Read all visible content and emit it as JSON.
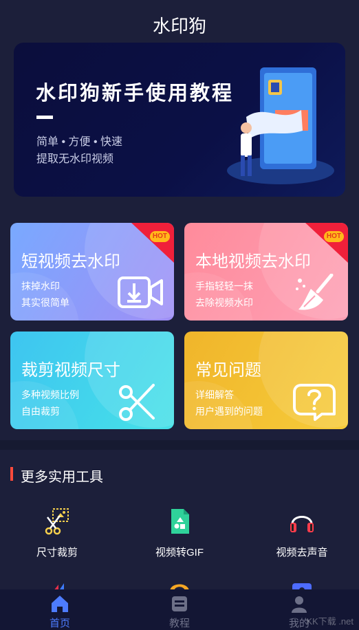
{
  "app": {
    "title": "水印狗"
  },
  "banner": {
    "title": "水印狗新手使用教程",
    "sub1": "简单 • 方便 • 快速",
    "sub2": "提取无水印视频"
  },
  "cards": [
    {
      "title": "短视频去水印",
      "line1": "抹掉水印",
      "line2": "其实很简单",
      "badge": "HOT",
      "icon": "video-download-icon"
    },
    {
      "title": "本地视频去水印",
      "line1": "手指轻轻一抹",
      "line2": "去除视频水印",
      "badge": "HOT",
      "icon": "broom-icon"
    },
    {
      "title": "裁剪视频尺寸",
      "line1": "多种视频比例",
      "line2": "自由裁剪",
      "icon": "scissors-icon"
    },
    {
      "title": "常见问题",
      "line1": "详细解答",
      "line2": "用户遇到的问题",
      "icon": "question-icon"
    }
  ],
  "tools_section": {
    "title": "更多实用工具",
    "items": [
      {
        "label": "尺寸裁剪",
        "icon": "crop-scissors-icon"
      },
      {
        "label": "视频转GIF",
        "icon": "gif-file-icon"
      },
      {
        "label": "视频去声音",
        "icon": "headphones-icon"
      }
    ]
  },
  "tabbar": {
    "items": [
      {
        "label": "首页",
        "icon": "home-icon",
        "active": true
      },
      {
        "label": "教程",
        "icon": "book-icon",
        "active": false
      },
      {
        "label": "我的",
        "icon": "user-icon",
        "active": false
      }
    ]
  },
  "watermark": "KK下载 .net",
  "colors": {
    "background": "#1c1f3a",
    "accent": "#4d7cff",
    "section_bar": "#ff4a3b",
    "hot_badge": "#ffb91a"
  }
}
